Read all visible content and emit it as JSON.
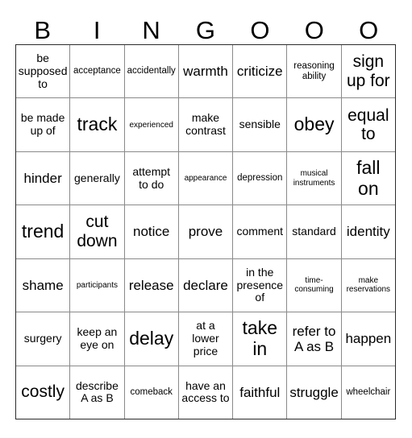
{
  "card": {
    "title": "BINGOOO",
    "header_letters": [
      "B",
      "I",
      "N",
      "G",
      "O",
      "O",
      "O"
    ],
    "columns": 7,
    "rows": 7,
    "colors": {
      "background": "#ffffff",
      "text": "#000000",
      "outer_border": "#2b2b2b",
      "inner_border": "#8a8a8a"
    },
    "cells": [
      [
        {
          "text": "be supposed to",
          "size": "sm"
        },
        {
          "text": "acceptance",
          "size": "xs"
        },
        {
          "text": "accidentally",
          "size": "xs"
        },
        {
          "text": "warmth",
          "size": "md"
        },
        {
          "text": "criticize",
          "size": "md"
        },
        {
          "text": "reasoning ability",
          "size": "xs"
        },
        {
          "text": "sign up for",
          "size": "lg"
        }
      ],
      [
        {
          "text": "be made up of",
          "size": "sm"
        },
        {
          "text": "track",
          "size": "xl"
        },
        {
          "text": "experienced",
          "size": "xxs"
        },
        {
          "text": "make contrast",
          "size": "sm"
        },
        {
          "text": "sensible",
          "size": "sm"
        },
        {
          "text": "obey",
          "size": "xl"
        },
        {
          "text": "equal to",
          "size": "lg"
        }
      ],
      [
        {
          "text": "hinder",
          "size": "md"
        },
        {
          "text": "generally",
          "size": "sm"
        },
        {
          "text": "attempt to do",
          "size": "sm"
        },
        {
          "text": "appearance",
          "size": "xxs"
        },
        {
          "text": "depression",
          "size": "xs"
        },
        {
          "text": "musical instruments",
          "size": "xxs"
        },
        {
          "text": "fall on",
          "size": "xl"
        }
      ],
      [
        {
          "text": "trend",
          "size": "xl"
        },
        {
          "text": "cut down",
          "size": "lg"
        },
        {
          "text": "notice",
          "size": "md"
        },
        {
          "text": "prove",
          "size": "md"
        },
        {
          "text": "comment",
          "size": "sm"
        },
        {
          "text": "standard",
          "size": "sm"
        },
        {
          "text": "identity",
          "size": "md"
        }
      ],
      [
        {
          "text": "shame",
          "size": "md"
        },
        {
          "text": "participants",
          "size": "xxs"
        },
        {
          "text": "release",
          "size": "md"
        },
        {
          "text": "declare",
          "size": "md"
        },
        {
          "text": "in the presence of",
          "size": "sm"
        },
        {
          "text": "time-consuming",
          "size": "xxs"
        },
        {
          "text": "make reservations",
          "size": "xxs"
        }
      ],
      [
        {
          "text": "surgery",
          "size": "sm"
        },
        {
          "text": "keep an eye on",
          "size": "sm"
        },
        {
          "text": "delay",
          "size": "xl"
        },
        {
          "text": "at a lower price",
          "size": "sm"
        },
        {
          "text": "take in",
          "size": "xl"
        },
        {
          "text": "refer to A as B",
          "size": "md"
        },
        {
          "text": "happen",
          "size": "md"
        }
      ],
      [
        {
          "text": "costly",
          "size": "lg"
        },
        {
          "text": "describe A as B",
          "size": "sm"
        },
        {
          "text": "comeback",
          "size": "xs"
        },
        {
          "text": "have an access to",
          "size": "sm"
        },
        {
          "text": "faithful",
          "size": "md"
        },
        {
          "text": "struggle",
          "size": "md"
        },
        {
          "text": "wheelchair",
          "size": "xs"
        }
      ]
    ]
  }
}
